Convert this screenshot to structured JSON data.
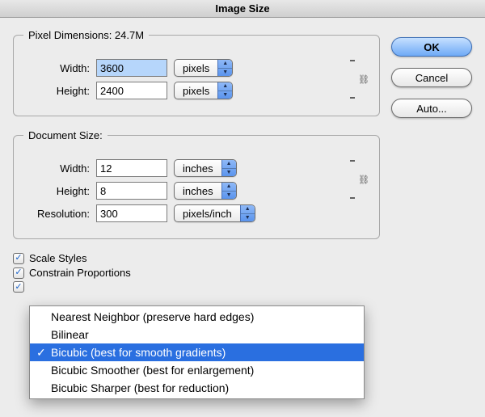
{
  "title": "Image Size",
  "pixel_dimensions": {
    "legend": "Pixel Dimensions:  24.7M",
    "width_label": "Width:",
    "width_value": "3600",
    "width_unit": "pixels",
    "height_label": "Height:",
    "height_value": "2400",
    "height_unit": "pixels"
  },
  "document_size": {
    "legend": "Document Size:",
    "width_label": "Width:",
    "width_value": "12",
    "width_unit": "inches",
    "height_label": "Height:",
    "height_value": "8",
    "height_unit": "inches",
    "resolution_label": "Resolution:",
    "resolution_value": "300",
    "resolution_unit": "pixels/inch"
  },
  "checkboxes": {
    "scale_styles": "Scale Styles",
    "constrain_proportions": "Constrain Proportions"
  },
  "buttons": {
    "ok": "OK",
    "cancel": "Cancel",
    "auto": "Auto..."
  },
  "resample_menu": {
    "items": [
      "Nearest Neighbor (preserve hard edges)",
      "Bilinear",
      "Bicubic (best for smooth gradients)",
      "Bicubic Smoother (best for enlargement)",
      "Bicubic Sharper (best for reduction)"
    ],
    "selected_index": 2,
    "checkmark": "✓"
  }
}
